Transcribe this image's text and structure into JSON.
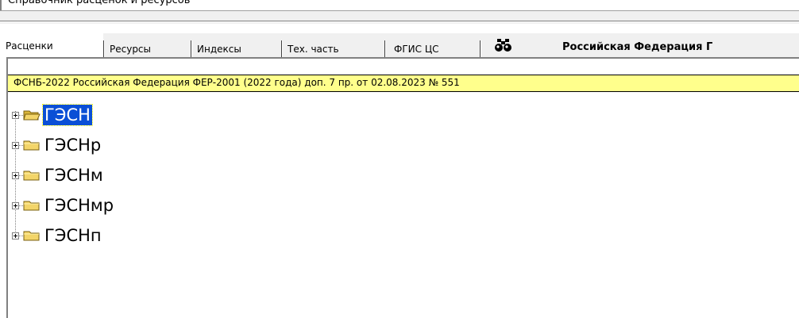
{
  "top_panel": {
    "partial_text": "Справочник расценок и ресурсов"
  },
  "tabs": [
    {
      "label": "Расценки",
      "active": true
    },
    {
      "label": "Ресурсы",
      "active": false
    },
    {
      "label": "Индексы",
      "active": false
    },
    {
      "label": "Тех. часть",
      "active": false
    },
    {
      "label": "ФГИС ЦС",
      "active": false
    }
  ],
  "search_icon": "binoculars-icon",
  "region_title": "Российская Федерация Г",
  "normative_base": "ФСНБ-2022 Российская Федерация ФЕР-2001 (2022 года) доп. 7 пр. от 02.08.2023 № 551",
  "tree": [
    {
      "label": "ГЭСН",
      "selected": true,
      "icon": "folder-open-icon"
    },
    {
      "label": "ГЭСНр",
      "selected": false,
      "icon": "folder-icon"
    },
    {
      "label": "ГЭСНм",
      "selected": false,
      "icon": "folder-icon"
    },
    {
      "label": "ГЭСНмр",
      "selected": false,
      "icon": "folder-icon"
    },
    {
      "label": "ГЭСНп",
      "selected": false,
      "icon": "folder-icon"
    }
  ],
  "colors": {
    "yellow_bar": "#ffff8c",
    "selection": "#0a4fd6",
    "folder": "#f3d569"
  }
}
